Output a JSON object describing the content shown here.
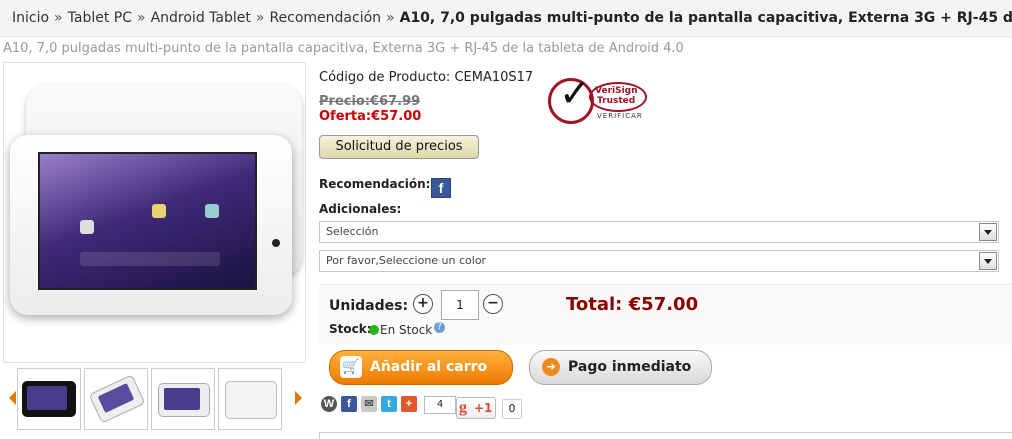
{
  "breadcrumb": {
    "items": [
      "Inicio",
      "Tablet PC",
      "Android Tablet",
      "Recomendación"
    ],
    "separator": "»",
    "current": "A10, 7,0 pulgadas multi-punto de la pantalla capacitiva, Externa 3G + RJ-45 de"
  },
  "product": {
    "subtitle": "A10, 7,0 pulgadas multi-punto de la pantalla capacitiva, Externa 3G + RJ-45 de la tableta de Android 4.0",
    "code": "Código de Producto: CEMA10S17",
    "old_price": "Precio:€67.99",
    "offer_price": "Oferta:€57.00",
    "request_price_label": "Solicitud de precios",
    "recommend_label": "Recomendación:",
    "additional_label": "Adicionales:",
    "select_options": {
      "selected": "Selección"
    },
    "select_color": {
      "selected": "Por favor,Seleccione un color"
    },
    "units_label": "Unidades:",
    "quantity": "1",
    "minus": "−",
    "plus": "+",
    "total": "Total: €57.00",
    "stock_label": "Stock:",
    "stock_value": "En Stock",
    "add_to_cart": "Añadir al carro",
    "buy_now": "Pago inmediato"
  },
  "seal": {
    "line1": "VeriSign",
    "line2": "Trusted",
    "line3": "VERIFICAR"
  },
  "social": {
    "share_count": "4",
    "gplus_label": "+1",
    "gplus_count": "0"
  },
  "colors": {
    "accent_orange": "#ee7a00",
    "price_red": "#cc0000",
    "total_red": "#8b0000",
    "verisign_red": "#a01226"
  },
  "icons": [
    "facebook-icon",
    "cart-icon",
    "arrow-right-icon",
    "wordpress-icon",
    "email-icon",
    "twitter-icon",
    "addthis-icon",
    "google-plus-icon",
    "help-icon"
  ]
}
